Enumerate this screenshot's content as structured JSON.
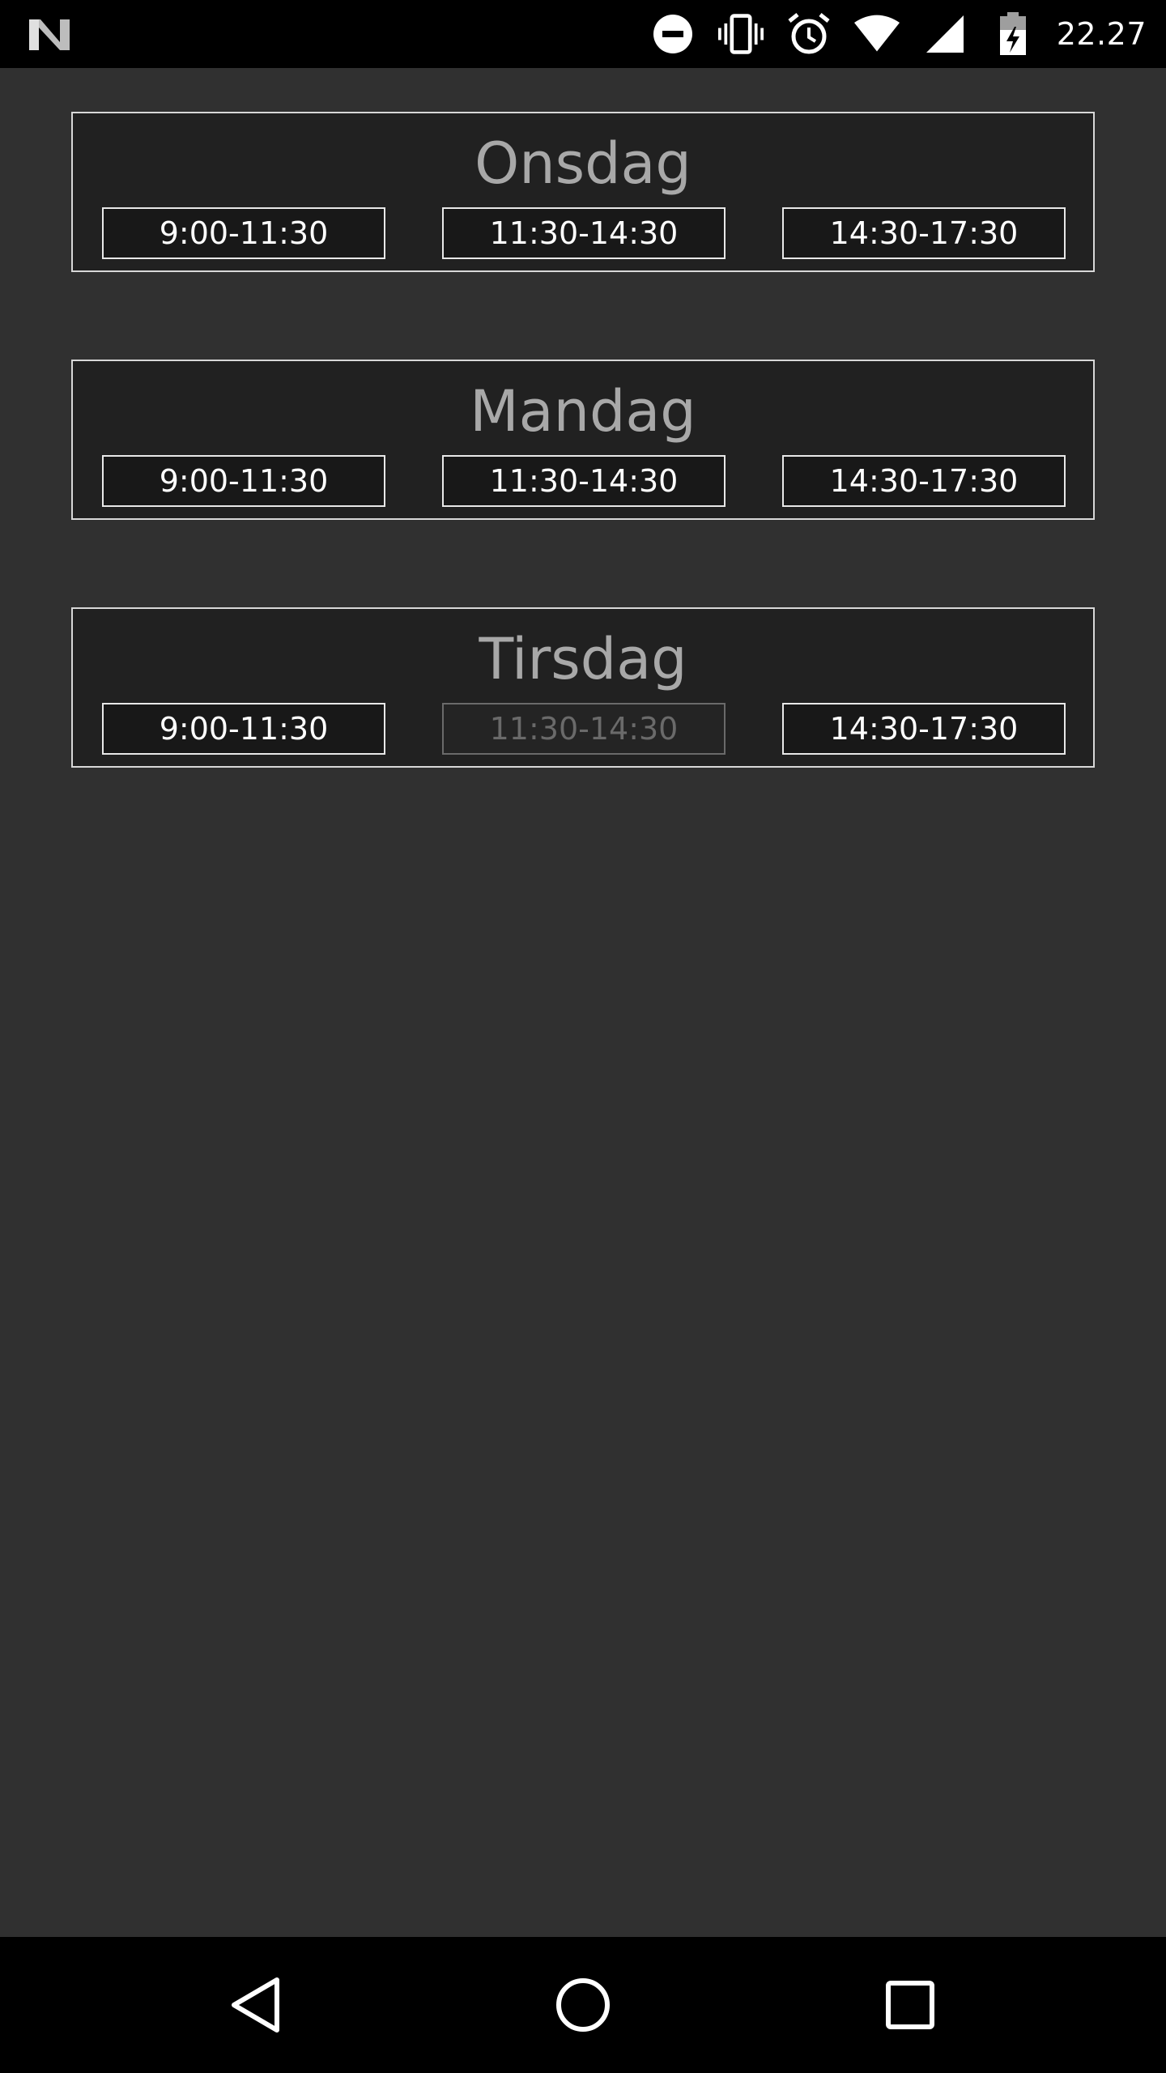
{
  "status_bar": {
    "time": "22.27",
    "icons": [
      "notification-n-icon",
      "do-not-disturb-icon",
      "vibrate-icon",
      "alarm-icon",
      "wifi-icon",
      "cell-signal-icon",
      "battery-charging-icon"
    ]
  },
  "days": [
    {
      "title": "Onsdag",
      "slots": [
        {
          "label": "9:00-11:30",
          "enabled": true
        },
        {
          "label": "11:30-14:30",
          "enabled": true
        },
        {
          "label": "14:30-17:30",
          "enabled": true
        }
      ]
    },
    {
      "title": "Mandag",
      "slots": [
        {
          "label": "9:00-11:30",
          "enabled": true
        },
        {
          "label": "11:30-14:30",
          "enabled": true
        },
        {
          "label": "14:30-17:30",
          "enabled": true
        }
      ]
    },
    {
      "title": "Tirsdag",
      "slots": [
        {
          "label": "9:00-11:30",
          "enabled": true
        },
        {
          "label": "11:30-14:30",
          "enabled": false
        },
        {
          "label": "14:30-17:30",
          "enabled": true
        }
      ]
    }
  ],
  "nav_bar": {
    "icons": [
      "back-icon",
      "home-icon",
      "recent-apps-icon"
    ]
  },
  "colors": {
    "background": "#303030",
    "card": "#212121",
    "card_border": "#d8d8d8",
    "title_text": "#a8a8a8",
    "slot_text": "#ffffff",
    "disabled_text": "#6a6a6a"
  }
}
